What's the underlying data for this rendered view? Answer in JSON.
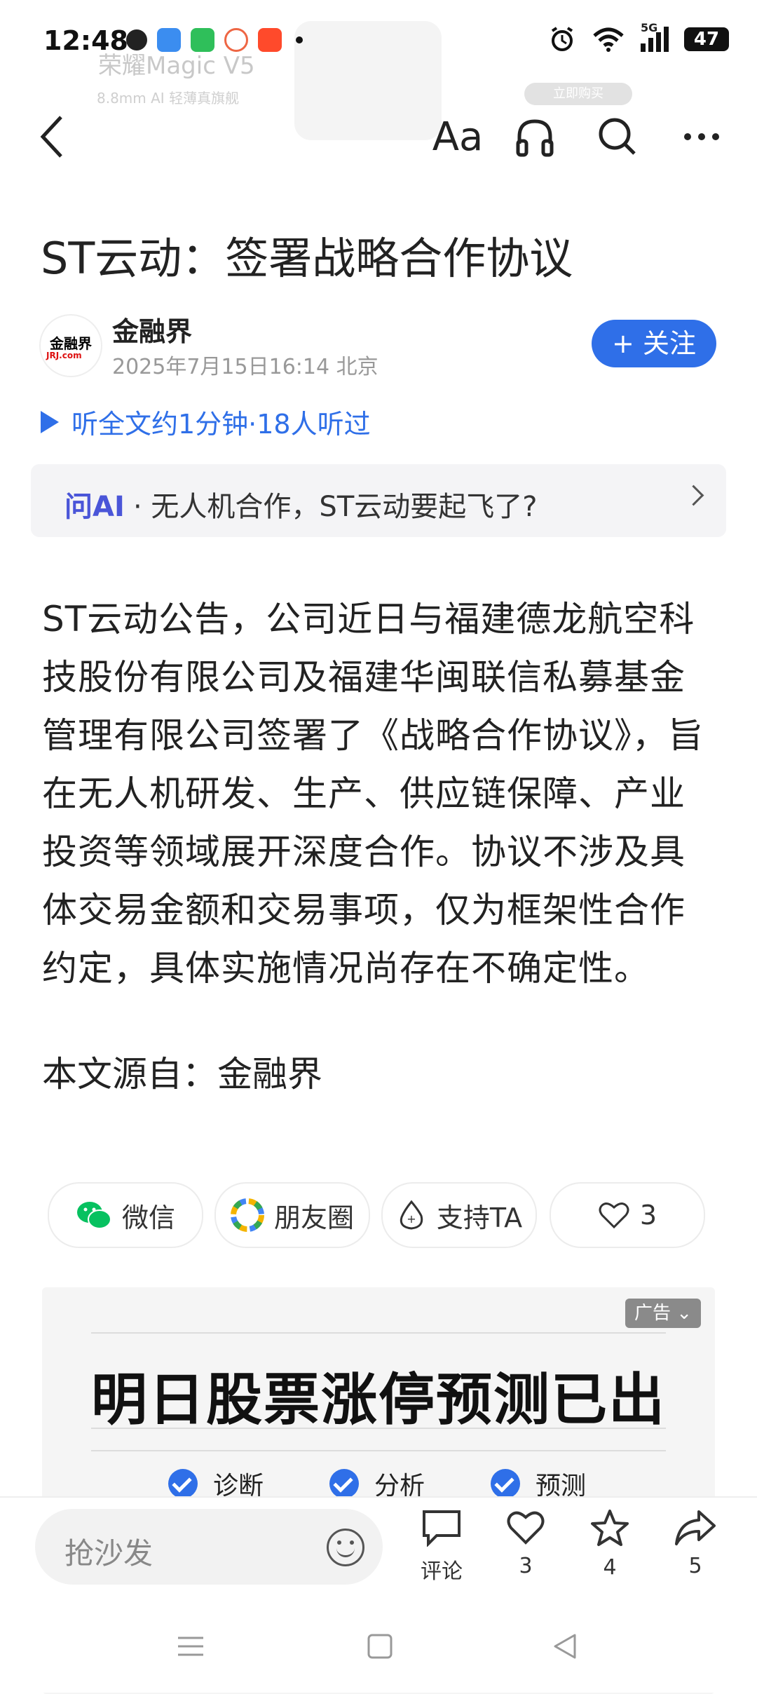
{
  "status_bar": {
    "time": "12:48",
    "network": "5G",
    "battery": "47"
  },
  "background_ad": {
    "brand": "荣耀Magic V5",
    "tagline": "8.8mm AI 轻薄真旗舰",
    "buy": "立即购买"
  },
  "toolbar": {
    "font_label": "Aa",
    "icons": [
      "back-icon",
      "font-size-icon",
      "headphones-icon",
      "search-icon",
      "more-icon"
    ]
  },
  "article": {
    "title": "ST云动：签署战略合作协议",
    "author": "金融界",
    "logo_text": "金融界",
    "logo_sub": "JRJ.com",
    "date": "2025年7月15日16:14 北京",
    "follow_label": "+ 关注",
    "listen": "听全文约1分钟·18人听过",
    "ai_label": "问AI",
    "ai_question": "· 无人机合作，ST云动要起飞了?",
    "body": "ST云动公告，公司近日与福建德龙航空科技股份有限公司及福建华闽联信私募基金管理有限公司签署了《战略合作协议》，旨在无人机研发、生产、供应链保障、产业投资等领域展开深度合作。协议不涉及具体交易金额和交易事项，仅为框架性合作约定，具体实施情况尚存在不确定性。",
    "source": "本文源自：金融界"
  },
  "share": {
    "wechat": "微信",
    "moments": "朋友圈",
    "support": "支持TA",
    "like_count": "3"
  },
  "ad": {
    "tag": "广告",
    "headline": "明日股票涨停预测已出",
    "items": [
      "诊断",
      "分析",
      "预测"
    ]
  },
  "bottom": {
    "placeholder": "抢沙发",
    "comment_label": "评论",
    "like_count": "3",
    "star_count": "4",
    "share_count": "5"
  },
  "colors": {
    "accent": "#2f6fe8",
    "ai": "#4a55d8",
    "wechat": "#07c160"
  }
}
